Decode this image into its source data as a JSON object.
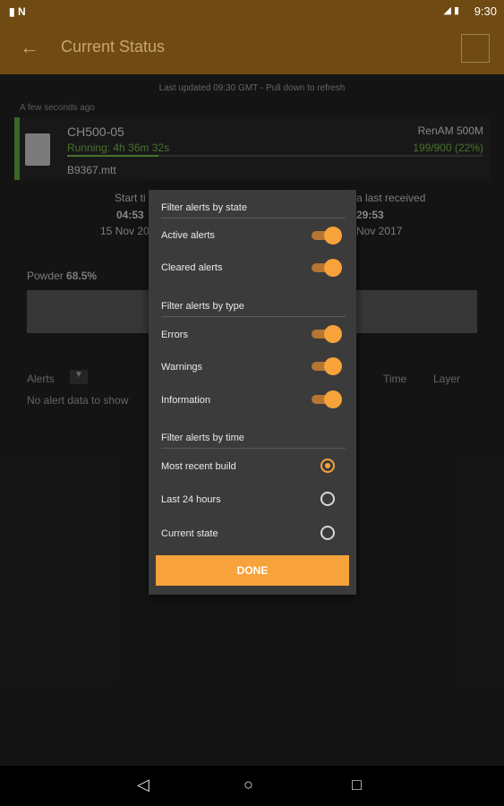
{
  "status_bar": {
    "time": "9:30",
    "left_icons": [
      "sd-card-icon",
      "n-icon"
    ],
    "right_icons": [
      "lte-signal-icon",
      "battery-icon"
    ]
  },
  "app_bar": {
    "title": "Current Status",
    "back_icon": "arrow-left-icon",
    "logo_icon": "renishaw-logo-icon"
  },
  "page": {
    "last_updated": "Last updated 09:30 GMT - Pull down to refresh",
    "ago": "A few seconds ago"
  },
  "machine_card": {
    "name": "CH500-05",
    "running": "Running: 4h 36m 32s",
    "file": "B9367.mtt",
    "model": "RenAM 500M",
    "layers": "199/900 (22%)",
    "progress_fraction": 0.22
  },
  "background": {
    "start_label_partial": "Start ti",
    "start_time_partial": "04:53",
    "start_date_partial": "15 Nov 20",
    "data_label_partial": "a last received",
    "data_time_partial": "29:53",
    "data_date_partial": "Nov 2017",
    "powder_label": "Powder",
    "powder_value": "68.5%",
    "alerts_label": "Alerts",
    "no_alert_data": "No alert data to show",
    "col_time": "Time",
    "col_layer": "Layer"
  },
  "dialog": {
    "sections": {
      "state": "Filter alerts by state",
      "type": "Filter alerts by type",
      "time": "Filter alerts by time"
    },
    "state_toggles": [
      {
        "label": "Active alerts",
        "on": true
      },
      {
        "label": "Cleared alerts",
        "on": true
      }
    ],
    "type_toggles": [
      {
        "label": "Errors",
        "on": true
      },
      {
        "label": "Warnings",
        "on": true
      },
      {
        "label": "Information",
        "on": true
      }
    ],
    "time_options": [
      {
        "label": "Most recent build",
        "selected": true
      },
      {
        "label": "Last 24 hours",
        "selected": false
      },
      {
        "label": "Current state",
        "selected": false
      }
    ],
    "done_label": "DONE",
    "accent_color": "#f7a23a"
  },
  "nav_bar": {
    "back_icon": "nav-back-icon",
    "home_icon": "nav-home-icon",
    "recents_icon": "nav-recents-icon"
  }
}
